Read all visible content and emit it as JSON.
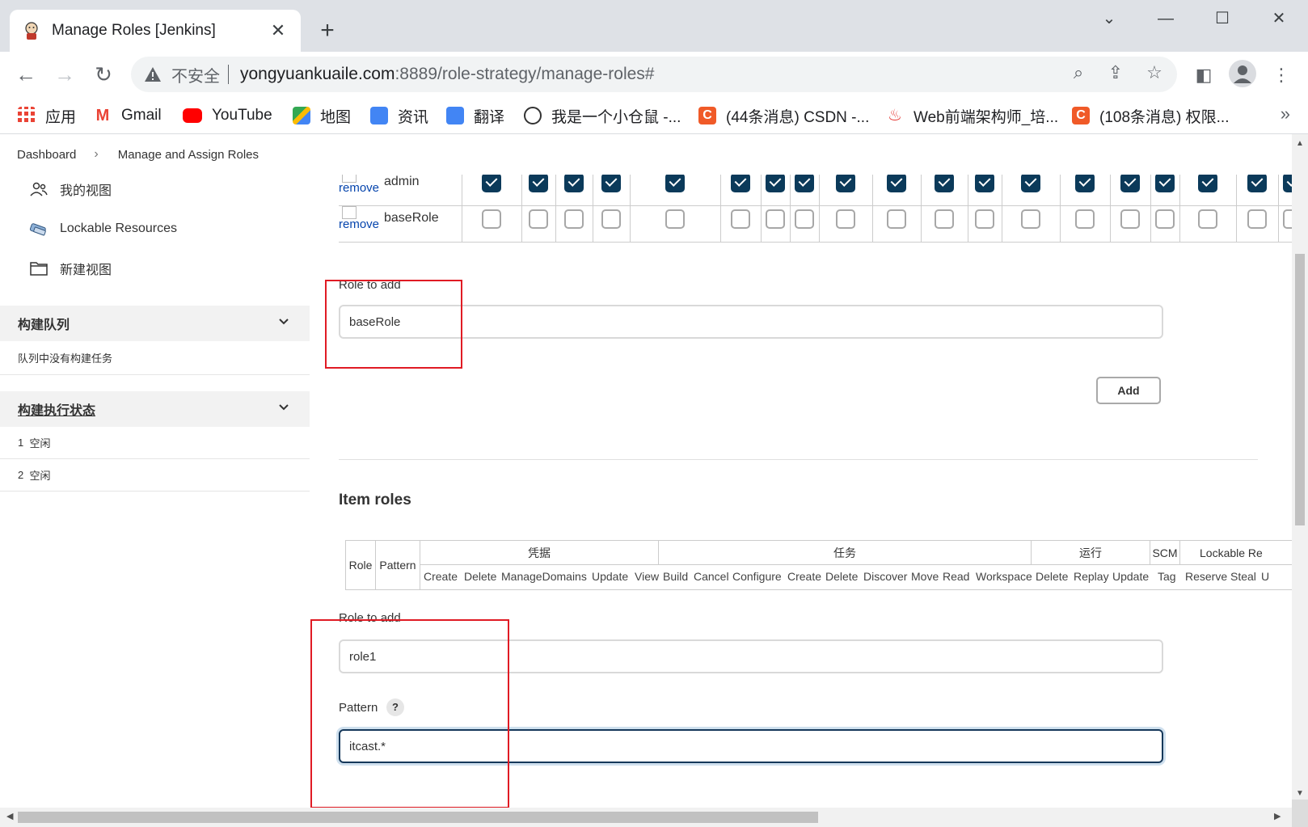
{
  "browser": {
    "tab_title": "Manage Roles [Jenkins]",
    "omnibox": {
      "security_label": "不安全",
      "url_host": "yongyuankuaile.com",
      "url_path": ":8889/role-strategy/manage-roles#"
    },
    "bookmarks": [
      {
        "label": "应用",
        "icon": "apps-grid-icon",
        "color": "#ea4335"
      },
      {
        "label": "Gmail",
        "icon": "gmail-icon",
        "color": "#ea4335"
      },
      {
        "label": "YouTube",
        "icon": "youtube-icon",
        "color": "#ff0000"
      },
      {
        "label": "地图",
        "icon": "maps-icon",
        "color": "#34a853"
      },
      {
        "label": "资讯",
        "icon": "news-icon",
        "color": "#4285f4"
      },
      {
        "label": "翻译",
        "icon": "translate-icon",
        "color": "#4285f4"
      },
      {
        "label": "我是一个小仓鼠 -...",
        "icon": "hamster-icon",
        "color": "#333333"
      },
      {
        "label": "(44条消息) CSDN -...",
        "icon": "csdn-icon",
        "color": "#f05a28"
      },
      {
        "label": "Web前端架构师_培...",
        "icon": "flame-icon",
        "color": "#e53935"
      },
      {
        "label": "(108条消息) 权限...",
        "icon": "csdn-icon",
        "color": "#f05a28"
      }
    ],
    "bookmarks_more": "»"
  },
  "breadcrumb": {
    "root": "Dashboard",
    "current": "Manage and Assign Roles"
  },
  "sidebar": {
    "items": [
      {
        "label": "我的视图",
        "icon": "people-icon"
      },
      {
        "label": "Lockable Resources",
        "icon": "lock-resources-icon"
      },
      {
        "label": "新建视图",
        "icon": "folder-icon"
      }
    ],
    "build_queue": {
      "title": "构建队列",
      "empty_text": "队列中没有构建任务"
    },
    "executors": {
      "title": "构建执行状态",
      "rows": [
        {
          "num": "1",
          "status": "空闲"
        },
        {
          "num": "2",
          "status": "空闲"
        }
      ]
    }
  },
  "global_roles": {
    "remove_label": "remove",
    "rows": [
      {
        "role": "admin",
        "checked": true
      },
      {
        "role": "baseRole",
        "checked": false
      }
    ],
    "role_to_add_label": "Role to add",
    "role_to_add_value": "baseRole",
    "add_label": "Add"
  },
  "item_roles": {
    "title": "Item roles",
    "col_role": "Role",
    "col_pattern": "Pattern",
    "groups": [
      "凭据",
      "任务",
      "运行",
      "SCM",
      "Lockable Re"
    ],
    "permissions": [
      "Create",
      "Delete",
      "ManageDomains",
      "Update",
      "View",
      "Build",
      "Cancel",
      "Configure",
      "Create",
      "Delete",
      "Discover",
      "Move",
      "Read",
      "Workspace",
      "Delete",
      "Replay",
      "Update",
      "Tag",
      "Reserve",
      "Steal",
      "U"
    ],
    "role_to_add_label": "Role to add",
    "role_to_add_value": "role1",
    "pattern_label": "Pattern",
    "pattern_help": "?",
    "pattern_value": "itcast.*"
  },
  "colors": {
    "checkbox_checked": "#0b3a5a",
    "highlight_box": "#e01b24",
    "link": "#0645ad"
  }
}
